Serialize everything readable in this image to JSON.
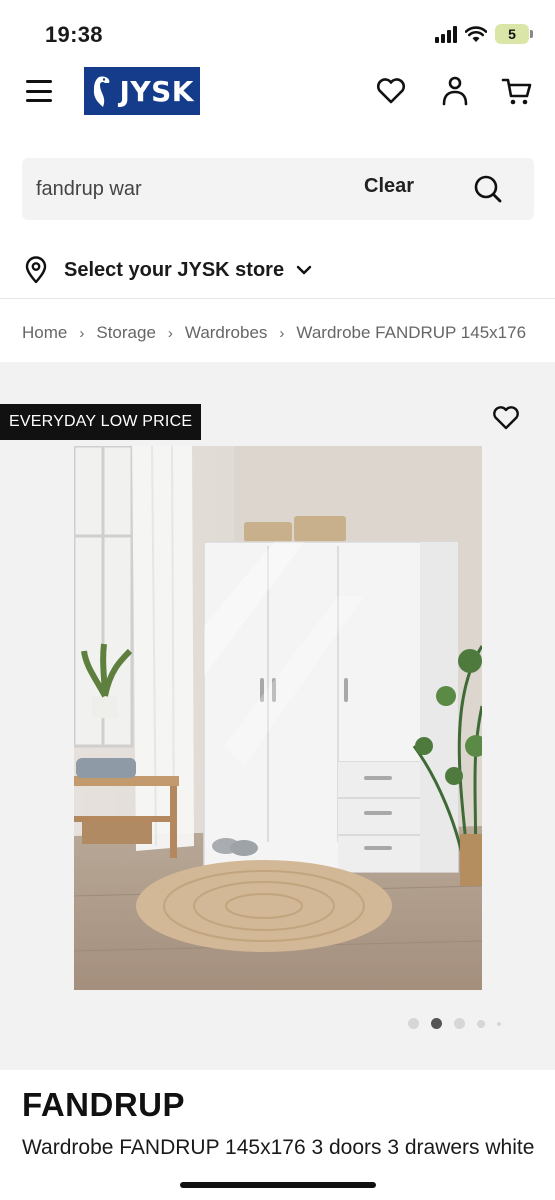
{
  "status_bar": {
    "time": "19:38",
    "battery": "5"
  },
  "header": {
    "brand": "JYSK"
  },
  "search": {
    "value": "fandrup war",
    "clear_label": "Clear"
  },
  "store": {
    "label": "Select your JYSK store"
  },
  "breadcrumb": [
    "Home",
    "Storage",
    "Wardrobes",
    "Wardrobe FANDRUP 145x176"
  ],
  "gallery": {
    "badge": "EVERYDAY LOW PRICE",
    "image_count": 5,
    "active_index": 1
  },
  "product": {
    "name": "FANDRUP",
    "description": "Wardrobe FANDRUP 145x176 3 doors 3 drawers white"
  },
  "colors": {
    "brand": "#143c8a",
    "badge_bg": "#111111",
    "gallery_bg": "#f2f2f2"
  },
  "icons": [
    "menu-icon",
    "heart-icon",
    "user-icon",
    "cart-icon",
    "search-icon",
    "location-pin-icon",
    "chevron-down-icon"
  ]
}
